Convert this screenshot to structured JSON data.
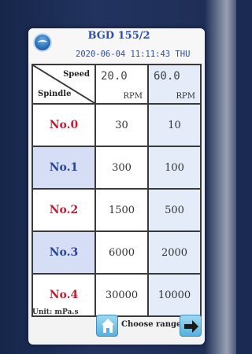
{
  "device": {
    "title": "BGD 155/2",
    "datetime": "2020-06-04 11:11:43 THU"
  },
  "table": {
    "corner": {
      "speed_label": "Speed",
      "spindle_label": "Spindle"
    },
    "speeds": [
      {
        "value": "20.0",
        "unit": "RPM"
      },
      {
        "value": "60.0",
        "unit": "RPM"
      }
    ],
    "rows": [
      {
        "spindle": "No.0",
        "values": [
          "30",
          "10"
        ]
      },
      {
        "spindle": "No.1",
        "values": [
          "300",
          "100"
        ]
      },
      {
        "spindle": "No.2",
        "values": [
          "1500",
          "500"
        ]
      },
      {
        "spindle": "No.3",
        "values": [
          "6000",
          "2000"
        ]
      },
      {
        "spindle": "No.4",
        "values": [
          "30000",
          "10000"
        ]
      }
    ]
  },
  "footer": {
    "unit_label": "Unit: mPa.s",
    "home_icon": "home-icon",
    "choose_range_label": "Choose range",
    "next_icon": "arrow-right-icon"
  },
  "colors": {
    "spindle_even": "#c21d35",
    "spindle_odd": "#28439c",
    "title": "#2c4fa8",
    "button": "#55b2de"
  }
}
